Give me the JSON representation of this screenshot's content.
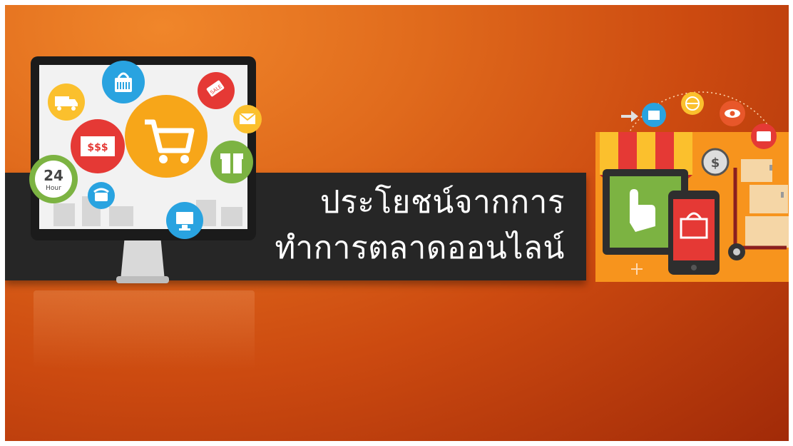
{
  "title": {
    "line1": "ประโยชน์จากการ",
    "line2": "ทำการตลาดออนไลน์"
  },
  "monitor_icons": {
    "price_label": "$$$",
    "hours_number": "24",
    "hours_unit": "Hour",
    "sale_tag": "SALE",
    "dollar_sign": "$"
  },
  "colors": {
    "background_light": "#f0862a",
    "background_dark": "#a12a08",
    "band": "#262626",
    "title_text": "#ffffff",
    "accent_orange": "#f7941d",
    "accent_red": "#e53935",
    "accent_green": "#7cb342",
    "accent_blue": "#29a3e0",
    "accent_yellow": "#fbc02d"
  },
  "icons": [
    "monitor-icon",
    "shopping-cart-icon",
    "shopping-bag-icon",
    "sale-tag-icon",
    "envelope-icon",
    "truck-icon",
    "money-icon",
    "24-hour-icon",
    "gift-icon",
    "telephone-icon",
    "computer-icon",
    "storefront-icon",
    "hand-pointer-icon",
    "smartphone-icon",
    "basket-icon",
    "globe-icon",
    "eye-icon",
    "contact-card-icon",
    "dollar-coin-icon",
    "hand-truck-icon",
    "arrow-icon",
    "plus-icon"
  ]
}
